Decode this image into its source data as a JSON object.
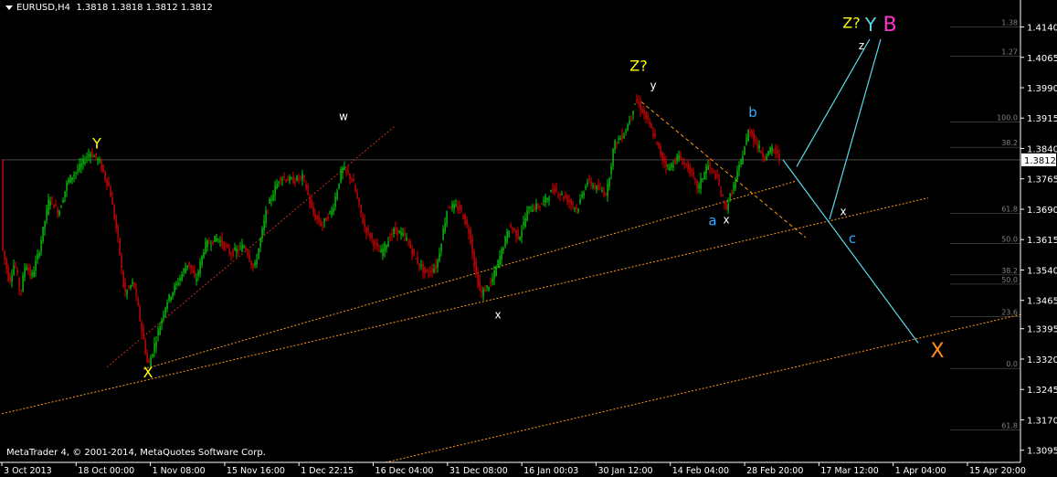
{
  "header": {
    "symbol_timeframe": "EURUSD,H4",
    "ohlc": "1.3818 1.3818 1.3812 1.3812"
  },
  "footer": {
    "copyright": "MetaTrader 4, © 2001-2014, MetaQuotes Software Corp."
  },
  "colors": {
    "background": "#000000",
    "bull": "#00d000",
    "bear": "#e00000",
    "trendline": "#ff9a1a",
    "wave_line": "#5ad8e8",
    "grid": "#303030",
    "axis_text": "#ffffff",
    "fib_text": "#808080"
  },
  "icons": {
    "dropdown": "triangle-down-icon"
  },
  "chart_data": {
    "type": "candlestick",
    "symbol": "EURUSD",
    "timeframe": "H4",
    "ylim": [
      1.3065,
      1.4175
    ],
    "y_ticks": [
      "1.4140",
      "1.4065",
      "1.3990",
      "1.3915",
      "1.3840",
      "1.3765",
      "1.3690",
      "1.3615",
      "1.3540",
      "1.3465",
      "1.3395",
      "1.3320",
      "1.3245",
      "1.3170",
      "1.3095"
    ],
    "current_price": "1.3812",
    "x_ticks": [
      "3 Oct 2013",
      "18 Oct 00:00",
      "1 Nov 08:00",
      "15 Nov 16:00",
      "1 Dec 22:15",
      "16 Dec 04:00",
      "31 Dec 08:00",
      "16 Jan 00:03",
      "30 Jan 12:00",
      "14 Feb 04:00",
      "28 Feb 20:00",
      "17 Mar 12:00",
      "1 Apr 04:00",
      "15 Apr 20:00"
    ],
    "fib_levels": [
      {
        "label": "1.38",
        "price": 1.414
      },
      {
        "label": "1.27",
        "price": 1.4068
      },
      {
        "label": "100.0",
        "price": 1.3905
      },
      {
        "label": "38.2",
        "price": 1.3843
      },
      {
        "label": "61.8",
        "price": 1.368
      },
      {
        "label": "50.0",
        "price": 1.3605
      },
      {
        "label": "38.2",
        "price": 1.3528
      },
      {
        "label": "50.0",
        "price": 1.3505
      },
      {
        "label": "23.6",
        "price": 1.3425
      },
      {
        "label": "0.0",
        "price": 1.3297
      },
      {
        "label": "61.8",
        "price": 1.3145
      }
    ],
    "path_points": [
      {
        "t": 0,
        "p": 1.36
      },
      {
        "t": 8,
        "p": 1.351
      },
      {
        "t": 14,
        "p": 1.356
      },
      {
        "t": 20,
        "p": 1.348
      },
      {
        "t": 26,
        "p": 1.356
      },
      {
        "t": 32,
        "p": 1.352
      },
      {
        "t": 40,
        "p": 1.358
      },
      {
        "t": 52,
        "p": 1.372
      },
      {
        "t": 62,
        "p": 1.368
      },
      {
        "t": 72,
        "p": 1.376
      },
      {
        "t": 84,
        "p": 1.379
      },
      {
        "t": 96,
        "p": 1.383
      },
      {
        "t": 106,
        "p": 1.381
      },
      {
        "t": 118,
        "p": 1.374
      },
      {
        "t": 128,
        "p": 1.36
      },
      {
        "t": 134,
        "p": 1.348
      },
      {
        "t": 144,
        "p": 1.351
      },
      {
        "t": 154,
        "p": 1.338
      },
      {
        "t": 160,
        "p": 1.33
      },
      {
        "t": 170,
        "p": 1.338
      },
      {
        "t": 180,
        "p": 1.346
      },
      {
        "t": 190,
        "p": 1.35
      },
      {
        "t": 204,
        "p": 1.356
      },
      {
        "t": 212,
        "p": 1.351
      },
      {
        "t": 222,
        "p": 1.36
      },
      {
        "t": 236,
        "p": 1.362
      },
      {
        "t": 250,
        "p": 1.358
      },
      {
        "t": 266,
        "p": 1.36
      },
      {
        "t": 276,
        "p": 1.354
      },
      {
        "t": 290,
        "p": 1.369
      },
      {
        "t": 304,
        "p": 1.377
      },
      {
        "t": 318,
        "p": 1.376
      },
      {
        "t": 330,
        "p": 1.377
      },
      {
        "t": 340,
        "p": 1.368
      },
      {
        "t": 350,
        "p": 1.365
      },
      {
        "t": 362,
        "p": 1.369
      },
      {
        "t": 372,
        "p": 1.379
      },
      {
        "t": 378,
        "p": 1.378
      },
      {
        "t": 384,
        "p": 1.376
      },
      {
        "t": 396,
        "p": 1.365
      },
      {
        "t": 404,
        "p": 1.362
      },
      {
        "t": 414,
        "p": 1.358
      },
      {
        "t": 430,
        "p": 1.364
      },
      {
        "t": 442,
        "p": 1.362
      },
      {
        "t": 452,
        "p": 1.357
      },
      {
        "t": 464,
        "p": 1.353
      },
      {
        "t": 476,
        "p": 1.355
      },
      {
        "t": 488,
        "p": 1.37
      },
      {
        "t": 502,
        "p": 1.369
      },
      {
        "t": 512,
        "p": 1.363
      },
      {
        "t": 518,
        "p": 1.354
      },
      {
        "t": 524,
        "p": 1.348
      },
      {
        "t": 536,
        "p": 1.351
      },
      {
        "t": 546,
        "p": 1.358
      },
      {
        "t": 556,
        "p": 1.365
      },
      {
        "t": 566,
        "p": 1.362
      },
      {
        "t": 576,
        "p": 1.369
      },
      {
        "t": 590,
        "p": 1.37
      },
      {
        "t": 604,
        "p": 1.374
      },
      {
        "t": 616,
        "p": 1.372
      },
      {
        "t": 630,
        "p": 1.369
      },
      {
        "t": 640,
        "p": 1.376
      },
      {
        "t": 652,
        "p": 1.374
      },
      {
        "t": 662,
        "p": 1.373
      },
      {
        "t": 670,
        "p": 1.385
      },
      {
        "t": 682,
        "p": 1.388
      },
      {
        "t": 694,
        "p": 1.396
      },
      {
        "t": 704,
        "p": 1.392
      },
      {
        "t": 712,
        "p": 1.388
      },
      {
        "t": 722,
        "p": 1.382
      },
      {
        "t": 730,
        "p": 1.379
      },
      {
        "t": 740,
        "p": 1.382
      },
      {
        "t": 752,
        "p": 1.379
      },
      {
        "t": 762,
        "p": 1.374
      },
      {
        "t": 772,
        "p": 1.38
      },
      {
        "t": 782,
        "p": 1.377
      },
      {
        "t": 792,
        "p": 1.369
      },
      {
        "t": 800,
        "p": 1.374
      },
      {
        "t": 808,
        "p": 1.38
      },
      {
        "t": 818,
        "p": 1.389
      },
      {
        "t": 826,
        "p": 1.385
      },
      {
        "t": 834,
        "p": 1.382
      },
      {
        "t": 844,
        "p": 1.384
      },
      {
        "t": 852,
        "p": 1.3812
      }
    ],
    "annotations": [
      {
        "text": "Y",
        "price": 1.384,
        "t": 104,
        "color": "#ffff00",
        "size": 16
      },
      {
        "text": "X",
        "price": 1.3275,
        "t": 160,
        "color": "#ffff00",
        "size": 16
      },
      {
        "text": "w",
        "price": 1.391,
        "t": 374,
        "color": "#ffffff",
        "size": 12
      },
      {
        "text": "x",
        "price": 1.342,
        "t": 543,
        "color": "#ffffff",
        "size": 12
      },
      {
        "text": "Z?",
        "price": 1.4032,
        "t": 697,
        "color": "#ffff00",
        "size": 16
      },
      {
        "text": "y",
        "price": 1.3987,
        "t": 713,
        "color": "#ffffff",
        "size": 12
      },
      {
        "text": "b",
        "price": 1.3918,
        "t": 822,
        "color": "#33aaff",
        "size": 15
      },
      {
        "text": "a",
        "price": 1.365,
        "t": 778,
        "color": "#33aaff",
        "size": 15
      },
      {
        "text": "x",
        "price": 1.3655,
        "t": 793,
        "color": "#ffffff",
        "size": 12
      },
      {
        "text": "x",
        "price": 1.3675,
        "t": 921,
        "color": "#ffffff",
        "size": 12
      },
      {
        "text": "c",
        "price": 1.3607,
        "t": 931,
        "color": "#33aaff",
        "size": 15
      },
      {
        "text": "X",
        "price": 1.3325,
        "t": 1024,
        "color": "#ff8c1a",
        "size": 22
      },
      {
        "text": "Z?",
        "price": 1.4138,
        "t": 930,
        "color": "#ffff00",
        "size": 16
      },
      {
        "text": "Y",
        "price": 1.413,
        "t": 951,
        "color": "#5ad8e8",
        "size": 20
      },
      {
        "text": "B",
        "price": 1.413,
        "t": 972,
        "color": "#ff33cc",
        "size": 22
      },
      {
        "text": "z",
        "price": 1.4085,
        "t": 941,
        "color": "#ffffff",
        "size": 12
      }
    ],
    "trendlines": [
      {
        "from": {
          "t": 115,
          "p": 1.33
        },
        "to": {
          "t": 430,
          "p": 1.3895
        },
        "style": "dotted",
        "color": "#c03020"
      },
      {
        "from": {
          "t": 0,
          "p": 1.3185
        },
        "to": {
          "t": 1014,
          "p": 1.3718
        },
        "style": "dotted",
        "color": "#ff9a1a"
      },
      {
        "from": {
          "t": 155,
          "p": 1.3295
        },
        "to": {
          "t": 870,
          "p": 1.376
        },
        "style": "dotted",
        "color": "#ff9a1a"
      },
      {
        "from": {
          "t": 420,
          "p": 1.3065
        },
        "to": {
          "t": 1115,
          "p": 1.343
        },
        "style": "dotted",
        "color": "#ff9a1a"
      },
      {
        "from": {
          "t": 700,
          "p": 1.3955
        },
        "to": {
          "t": 880,
          "p": 1.362
        },
        "style": "dashed",
        "color": "#ff9a1a"
      }
    ],
    "wave_lines": [
      {
        "from": {
          "t": 870,
          "p": 1.3795
        },
        "to": {
          "t": 950,
          "p": 1.411
        }
      },
      {
        "from": {
          "t": 855,
          "p": 1.3812
        },
        "to": {
          "t": 1003,
          "p": 1.336
        }
      },
      {
        "from": {
          "t": 906,
          "p": 1.3665
        },
        "to": {
          "t": 962,
          "p": 1.411
        }
      }
    ]
  }
}
